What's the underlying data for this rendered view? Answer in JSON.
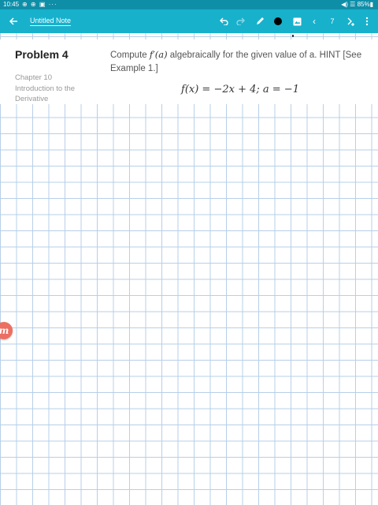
{
  "status_bar": {
    "time": "10:45",
    "left_icons": "⊕ ⊕ ▣ ···",
    "right_text": "◀) ☰ 85%▮"
  },
  "toolbar": {
    "title": "Untitled Note",
    "page_number": "7",
    "prev_symbol": "‹",
    "icons": [
      "back-arrow-icon",
      "undo-icon",
      "redo-icon",
      "pen-icon",
      "color-icon",
      "image-icon",
      "chevron-left-icon",
      "next-add-icon",
      "more-vertical-icon"
    ],
    "colors": {
      "status_bar": "#0f8ea8",
      "toolbar": "#17b1cc",
      "selected_pen_color": "#000000"
    }
  },
  "problem": {
    "title": "Problem 4",
    "chapter": "Chapter 10",
    "topic_line1": "Introduction to the",
    "topic_line2": "Derivative",
    "prompt_before": "Compute ",
    "prompt_math": "f′(a)",
    "prompt_after": " algebraically for the given value of a. HINT [See Example 1.]",
    "formula": "f(x) = −2x + 4; a = −1"
  },
  "floating_badge": {
    "label": "m",
    "color": "#ec6f62"
  },
  "grid": {
    "line_color": "#b7cfe8"
  }
}
